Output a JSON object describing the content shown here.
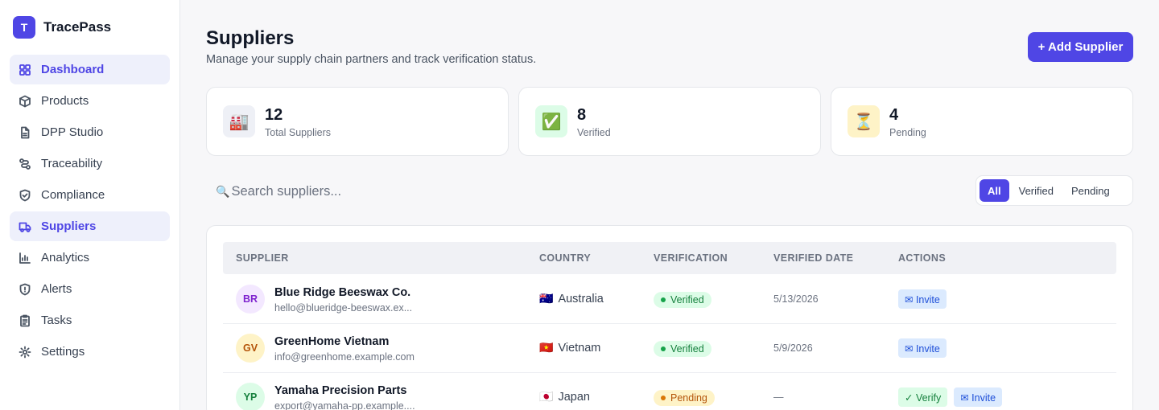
{
  "app": {
    "logo_letter": "T",
    "name": "TracePass"
  },
  "sidebar": {
    "items": [
      {
        "label": "Dashboard",
        "icon": "dashboard-icon"
      },
      {
        "label": "Products",
        "icon": "box-icon"
      },
      {
        "label": "DPP Studio",
        "icon": "document-icon"
      },
      {
        "label": "Traceability",
        "icon": "route-icon"
      },
      {
        "label": "Compliance",
        "icon": "shield-check-icon"
      },
      {
        "label": "Suppliers",
        "icon": "truck-icon"
      },
      {
        "label": "Analytics",
        "icon": "bar-chart-icon"
      },
      {
        "label": "Alerts",
        "icon": "alert-shield-icon"
      },
      {
        "label": "Tasks",
        "icon": "clipboard-icon"
      },
      {
        "label": "Settings",
        "icon": "gear-icon"
      }
    ],
    "active": "Suppliers"
  },
  "header": {
    "title": "Suppliers",
    "subtitle": "Manage your supply chain partners and track verification status.",
    "add_button": "+ Add Supplier"
  },
  "stats": [
    {
      "icon": "🏭",
      "value": "12",
      "label": "Total Suppliers",
      "bg": "#eef0f6"
    },
    {
      "icon": "✅",
      "value": "8",
      "label": "Verified",
      "bg": "#dcfce7"
    },
    {
      "icon": "⏳",
      "value": "4",
      "label": "Pending",
      "bg": "#fef3c7"
    }
  ],
  "search": {
    "icon": "🔍",
    "placeholder": "Search suppliers..."
  },
  "filters": {
    "options": [
      "All",
      "Verified",
      "Pending"
    ],
    "active": "All"
  },
  "table": {
    "columns": [
      "SUPPLIER",
      "COUNTRY",
      "VERIFICATION",
      "VERIFIED DATE",
      "ACTIONS"
    ],
    "rows": [
      {
        "initials": "BR",
        "avatar_bg": "#f3e8ff",
        "avatar_fg": "#7e22ce",
        "name": "Blue Ridge Beeswax Co.",
        "email": "hello@blueridge-beeswax.ex...",
        "flag": "🇦🇺",
        "country": "Australia",
        "status": "Verified",
        "status_type": "verified",
        "date": "5/13/2026",
        "actions": [
          {
            "label": "✉ Invite",
            "type": "invite"
          }
        ]
      },
      {
        "initials": "GV",
        "avatar_bg": "#fef3c7",
        "avatar_fg": "#b45309",
        "name": "GreenHome Vietnam",
        "email": "info@greenhome.example.com",
        "flag": "🇻🇳",
        "country": "Vietnam",
        "status": "Verified",
        "status_type": "verified",
        "date": "5/9/2026",
        "actions": [
          {
            "label": "✉ Invite",
            "type": "invite"
          }
        ]
      },
      {
        "initials": "YP",
        "avatar_bg": "#dcfce7",
        "avatar_fg": "#15803d",
        "name": "Yamaha Precision Parts",
        "email": "export@yamaha-pp.example....",
        "flag": "🇯🇵",
        "country": "Japan",
        "status": "Pending",
        "status_type": "pending",
        "date": "—",
        "actions": [
          {
            "label": "✓ Verify",
            "type": "verify"
          },
          {
            "label": "✉ Invite",
            "type": "invite"
          }
        ]
      }
    ]
  }
}
